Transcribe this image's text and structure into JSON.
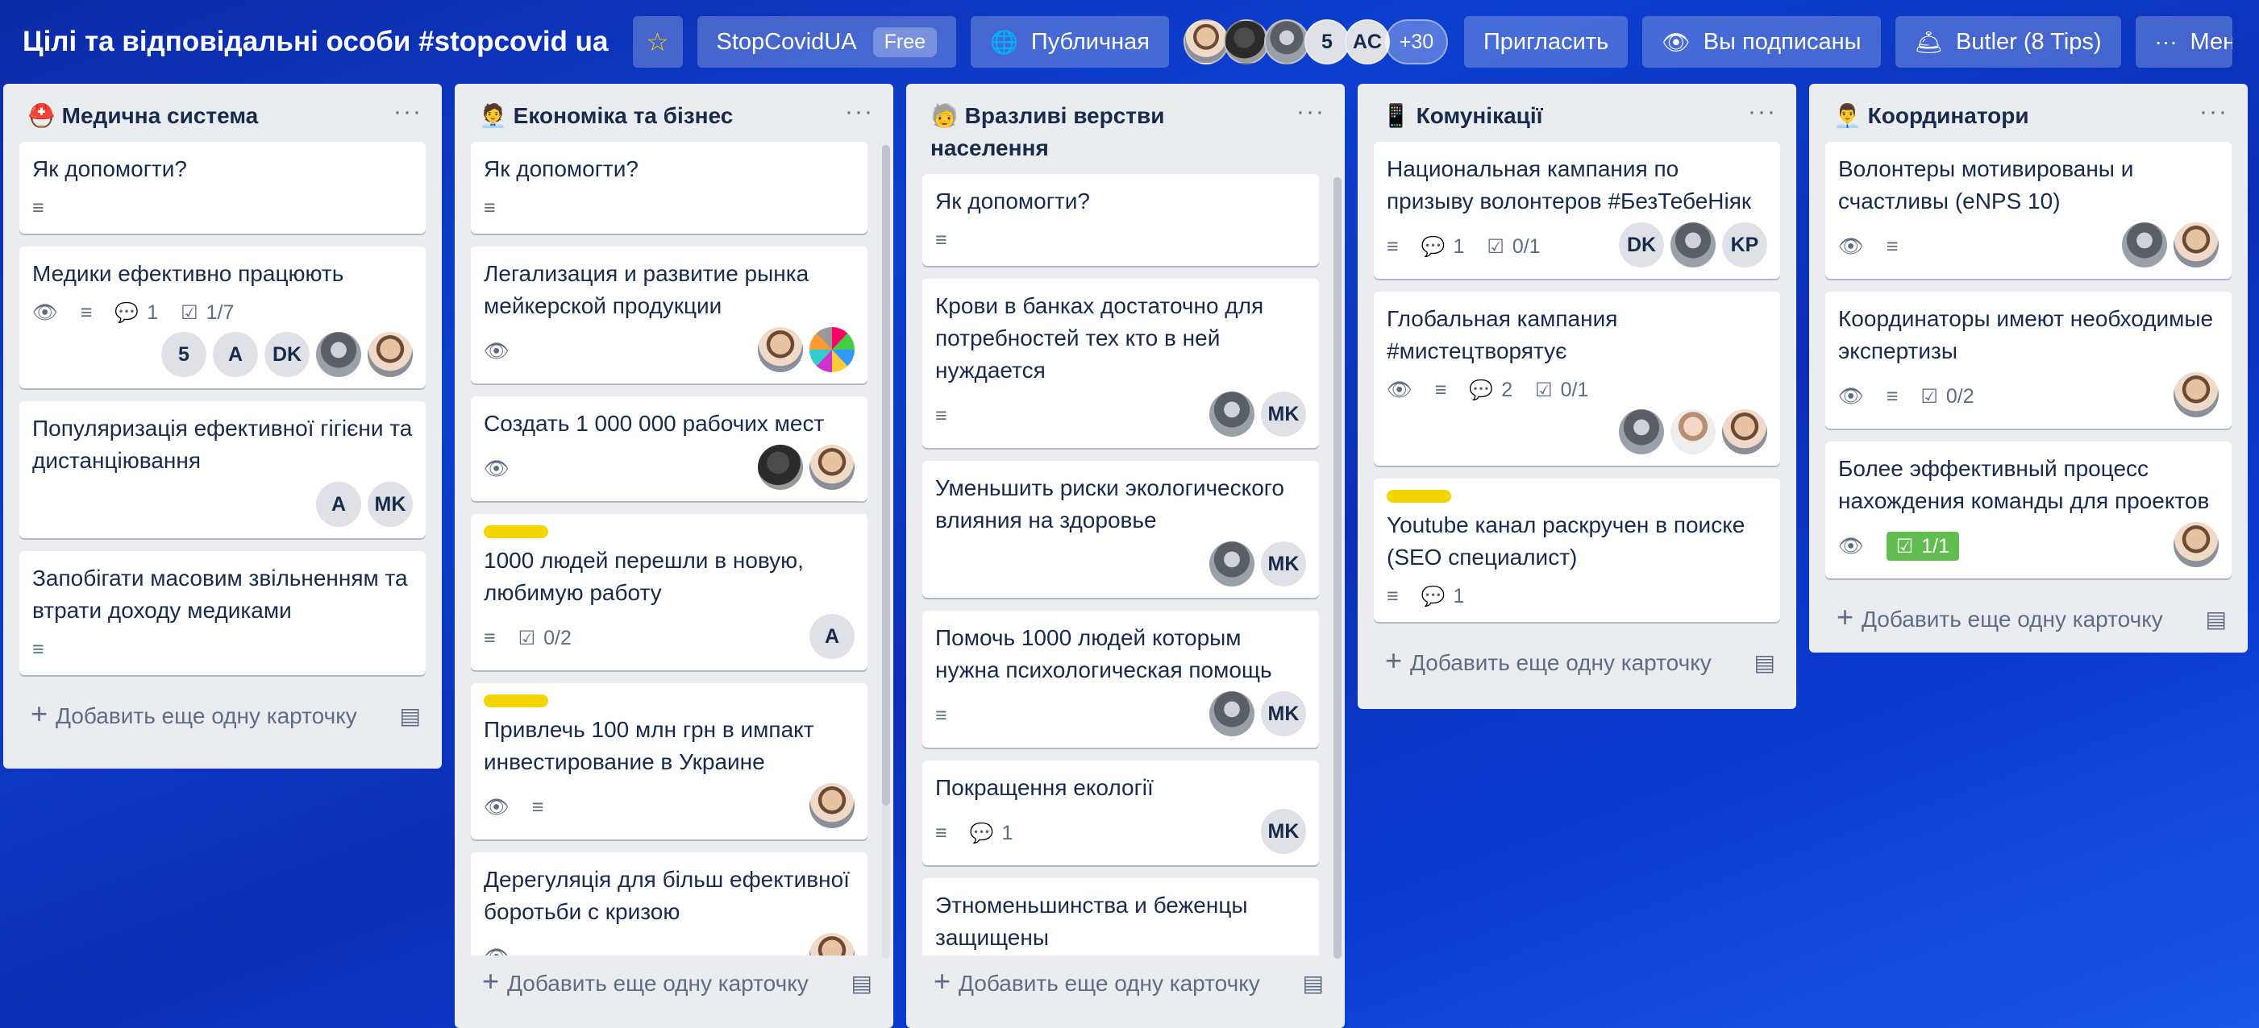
{
  "header": {
    "board_title": "Цілі та відповідальні особи #stopcovid ua",
    "workspace": "StopCovidUA",
    "workspace_badge": "Free",
    "visibility": "Публичная",
    "member_count_chip": "5",
    "member_initials": "AC",
    "more_members": "+30",
    "invite": "Пригласить",
    "watching": "Вы подписаны",
    "butler": "Butler (8 Tips)",
    "menu": "Меню"
  },
  "lists": [
    {
      "title": "Медична система",
      "emoji": "⛑️",
      "add_card": "Добавить еще одну карточку",
      "cards": [
        {
          "title": "Як допомогти?"
        },
        {
          "title": "Медики ефективно працюють",
          "comments": "1",
          "checklist": "1/7",
          "members": [
            "5",
            "A",
            "DK"
          ]
        },
        {
          "title": "Популяризація ефективної гігієни та дистанціювання",
          "members": [
            "A",
            "MK"
          ]
        },
        {
          "title": "Запобігати масовим звільненням та втрати доходу медиками"
        }
      ]
    },
    {
      "title": "Економіка та бізнес",
      "emoji": "🧑‍💼",
      "add_card": "Добавить еще одну карточку",
      "cards": [
        {
          "title": "Як допомогти?"
        },
        {
          "title": "Легализация и развитие рынка мейкерской продукции"
        },
        {
          "title": "Создать 1 000 000 рабочих мест"
        },
        {
          "title": "1000 людей перешли в новую, любимую работу",
          "checklist": "0/2",
          "members": [
            "A"
          ]
        },
        {
          "title": "Привлечь 100 млн грн в импакт инвестирование в Украине"
        },
        {
          "title": "Дерегуляція для більш ефективної боротьби с кризою"
        }
      ]
    },
    {
      "title": "Вразливі верстви населення",
      "emoji": "🧓",
      "add_card": "Добавить еще одну карточку",
      "cards": [
        {
          "title": "Як допомогти?"
        },
        {
          "title": "Крови в банках достаточно для потребностей тех кто в ней нуждается",
          "members": [
            "MK"
          ]
        },
        {
          "title": "Уменьшить риски экологического влияния на здоровье",
          "members": [
            "MK"
          ]
        },
        {
          "title": "Помочь 1000 людей которым нужна психологическая помощь",
          "members": [
            "MK"
          ]
        },
        {
          "title": "Покращення екології",
          "comments": "1",
          "members": [
            "MK"
          ]
        },
        {
          "title": "Этноменьшинства и беженцы защищены"
        }
      ]
    },
    {
      "title": "Комунікації",
      "emoji": "📱",
      "add_card": "Добавить еще одну карточку",
      "cards": [
        {
          "title": "Национальная кампания по призыву волонтеров #БезТебеНіяк",
          "comments": "1",
          "checklist": "0/1",
          "members": [
            "DK",
            "KP"
          ]
        },
        {
          "title": "Глобальная кампания #мистецтворятує",
          "comments": "2",
          "checklist": "0/1"
        },
        {
          "title": "Youtube канал раскручен в поиске (SEO специалист)",
          "comments": "1"
        }
      ]
    },
    {
      "title": "Координатори",
      "emoji": "👨‍💼",
      "add_card": "Добавить еще одну карточку",
      "cards": [
        {
          "title": "Волонтеры мотивированы и счастливы (eNPS 10)"
        },
        {
          "title": "Координаторы имеют необходимые экспертизы",
          "checklist": "0/2"
        },
        {
          "title": "Более эффективный процесс нахождения команды для проектов",
          "checklist": "1/1"
        }
      ]
    }
  ],
  "colors": {
    "label_yellow": "#f2d600",
    "checklist_done": "#61bd4f",
    "list_bg": "#ebecf0"
  }
}
